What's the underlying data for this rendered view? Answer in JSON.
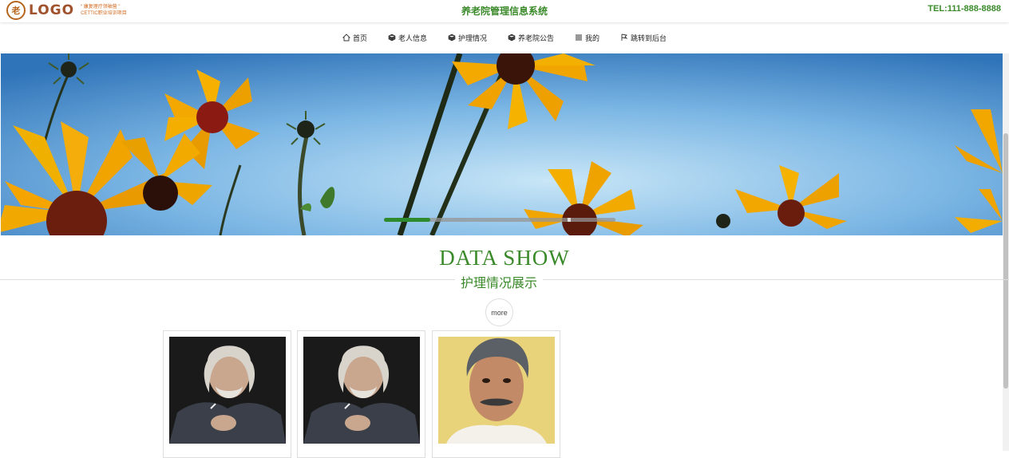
{
  "header": {
    "logo_text": "LOGO",
    "logo_tag_line1": "“ 康复理疗领袖营 ”",
    "logo_tag_line2": "CETTIC职业培训项目",
    "site_title": "养老院管理信息系统",
    "tel": "TEL:111-888-8888"
  },
  "nav": [
    {
      "label": "首页",
      "icon": "home-icon"
    },
    {
      "label": "老人信息",
      "icon": "cube-icon"
    },
    {
      "label": "护理情况",
      "icon": "cube-icon"
    },
    {
      "label": "养老院公告",
      "icon": "cube-icon"
    },
    {
      "label": "我的",
      "icon": "menu-icon"
    },
    {
      "label": "跳转到后台",
      "icon": "flag-icon"
    }
  ],
  "banner": {
    "slides_progress": 0.2
  },
  "section": {
    "title": "DATA SHOW",
    "subtitle": "护理情况展示",
    "more_label": "more"
  },
  "cards": [
    {
      "image": "elderly-man-smoking-portrait"
    },
    {
      "image": "elderly-man-smoking-portrait"
    },
    {
      "image": "elderly-man-yellow-background-portrait"
    }
  ],
  "colors": {
    "accent": "#3a8a2a",
    "logo": "#a0522d"
  }
}
